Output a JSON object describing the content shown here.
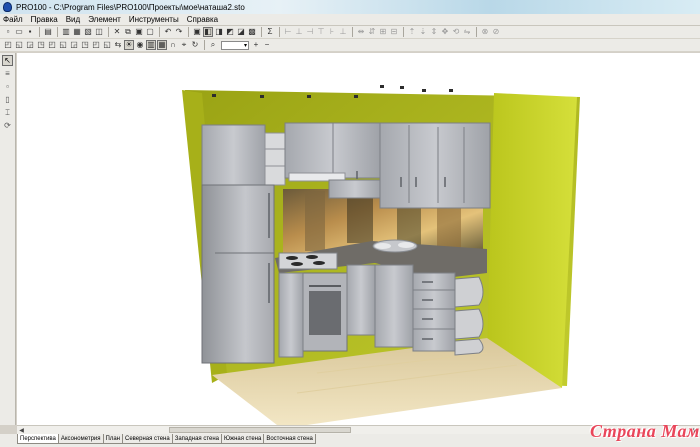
{
  "window": {
    "title": "PRO100 - C:\\Program Files\\PRO100\\Проекты\\мое\\наташа2.sto"
  },
  "menu": [
    {
      "label": "Файл"
    },
    {
      "label": "Правка"
    },
    {
      "label": "Вид"
    },
    {
      "label": "Элемент"
    },
    {
      "label": "Инструменты"
    },
    {
      "label": "Справка"
    }
  ],
  "toolbar": {
    "zoom_value": "▾",
    "sigma_symbol": "Σ"
  },
  "tabs": [
    {
      "label": "Перспектива",
      "active": true
    },
    {
      "label": "Аксонометрия",
      "active": false
    },
    {
      "label": "План",
      "active": false
    },
    {
      "label": "Северная стена",
      "active": false
    },
    {
      "label": "Западная стена",
      "active": false
    },
    {
      "label": "Южная стена",
      "active": false
    },
    {
      "label": "Восточная стена",
      "active": false
    }
  ],
  "watermark": "Страна Мам",
  "colors": {
    "wall": "#b9c41a",
    "floor": "#e9d9a8",
    "cabinet": "#b7b9bf",
    "countertop": "#6e6b66"
  }
}
